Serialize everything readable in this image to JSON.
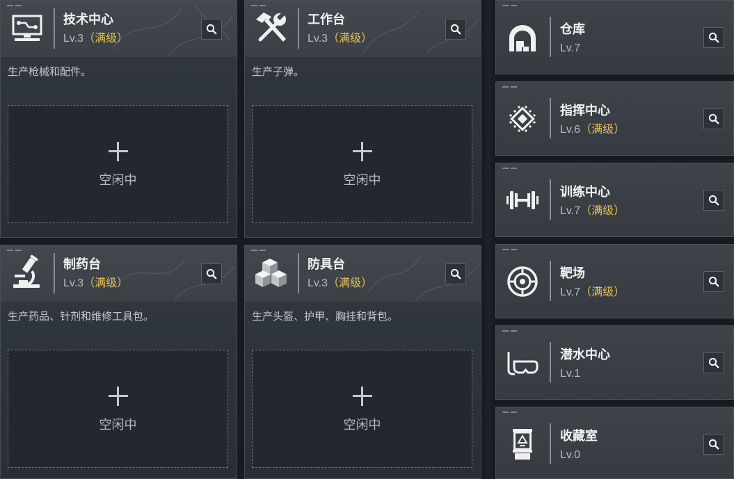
{
  "production": [
    {
      "title": "技术中心",
      "level": "Lv.3",
      "max_tag": "（满级）",
      "icon": "monitor-circuit-icon",
      "description": "生产枪械和配件。",
      "slot_status": "空闲中"
    },
    {
      "title": "工作台",
      "level": "Lv.3",
      "max_tag": "（满级）",
      "icon": "hammer-wrench-icon",
      "description": "生产子弹。",
      "slot_status": "空闲中"
    },
    {
      "title": "制药台",
      "level": "Lv.3",
      "max_tag": "（满级）",
      "icon": "microscope-icon",
      "description": "生产药品、针剂和维修工具包。",
      "slot_status": "空闲中"
    },
    {
      "title": "防具台",
      "level": "Lv.3",
      "max_tag": "（满级）",
      "icon": "cubes-icon",
      "description": "生产头盔、护甲、胸挂和背包。",
      "slot_status": "空闲中"
    }
  ],
  "facilities": [
    {
      "title": "仓库",
      "level": "Lv.7",
      "icon": "warehouse-icon"
    },
    {
      "title": "指挥中心",
      "level": "Lv.6",
      "max_tag": "（满级）",
      "icon": "command-chip-icon"
    },
    {
      "title": "训练中心",
      "level": "Lv.7",
      "max_tag": "（满级）",
      "icon": "dumbbell-icon"
    },
    {
      "title": "靶场",
      "level": "Lv.7",
      "max_tag": "（满级）",
      "icon": "target-icon"
    },
    {
      "title": "潜水中心",
      "level": "Lv.1",
      "icon": "diving-mask-icon"
    },
    {
      "title": "收藏室",
      "level": "Lv.0",
      "icon": "display-case-icon"
    }
  ],
  "icons": {
    "inspect": "search-icon",
    "add_slot": "plus-icon"
  },
  "colors": {
    "page_background": "#161b1f",
    "card_header": "#3e4349",
    "card_body": "#2b3138",
    "title_text": "#f2f2f2",
    "level_text": "#b9bdc1",
    "max_level_tag": "#e3bf55"
  }
}
